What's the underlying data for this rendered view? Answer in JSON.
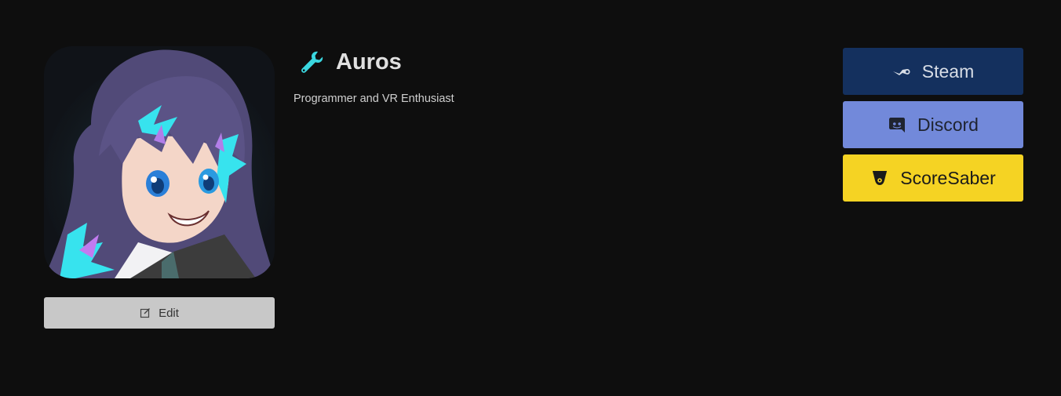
{
  "profile": {
    "name": "Auros",
    "bio": "Programmer and VR Enthusiast",
    "name_icon": "wrench-icon",
    "edit_label": "Edit",
    "edit_icon": "edit-icon"
  },
  "socials": [
    {
      "label": "Steam",
      "icon": "steam-icon",
      "bg": "#14305e",
      "fg": "#d8dde6"
    },
    {
      "label": "Discord",
      "icon": "discord-icon",
      "bg": "#7289da",
      "fg": "#1f2430"
    },
    {
      "label": "ScoreSaber",
      "icon": "scoresaber-icon",
      "bg": "#f5d323",
      "fg": "#1a1a1a"
    }
  ],
  "colors": {
    "background": "#0e0e0e",
    "accent": "#3ad7e0",
    "edit_button": "#c8c8c8"
  }
}
